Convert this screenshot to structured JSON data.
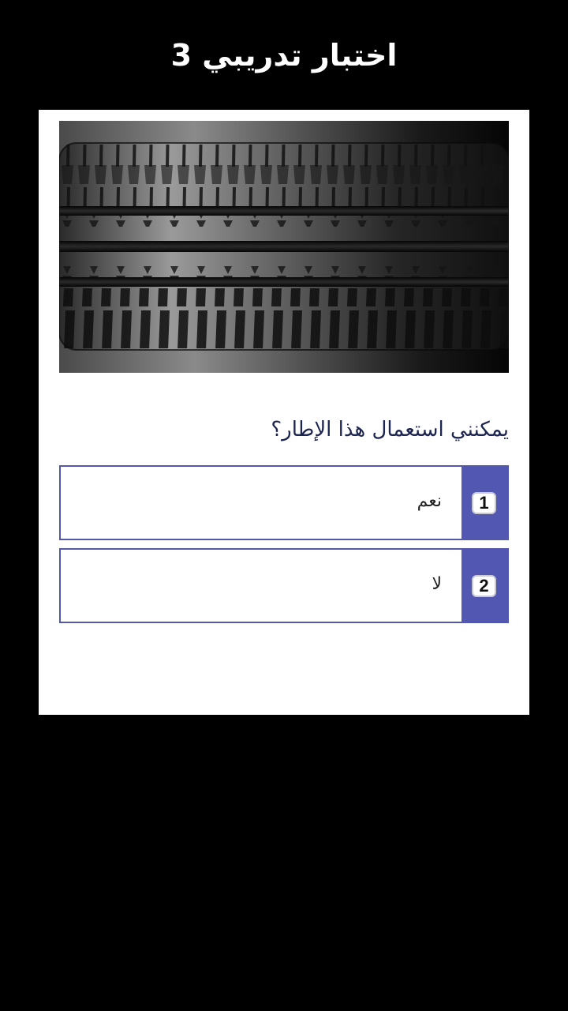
{
  "header": {
    "title": "اختبار تدريبي 3"
  },
  "question": {
    "image_alt": "tire-tread-image",
    "text": "يمكنني استعمال هذا الإطار؟"
  },
  "answers": [
    {
      "number": "1",
      "text": "نعم"
    },
    {
      "number": "2",
      "text": "لا"
    }
  ],
  "colors": {
    "background": "#000000",
    "card": "#ffffff",
    "accent": "#5257b2",
    "question_text": "#1c2450"
  }
}
